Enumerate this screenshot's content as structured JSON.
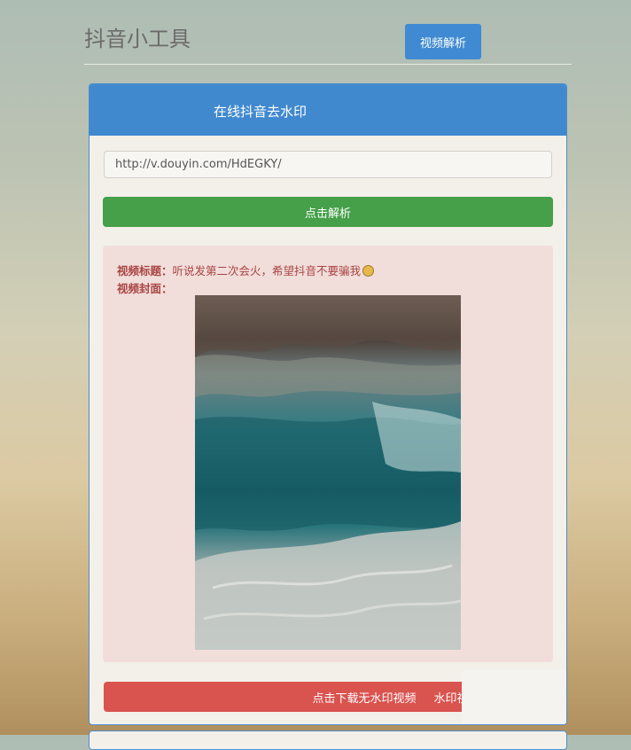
{
  "header": {
    "site_title": "抖音小工具",
    "nav_button": "视频解析"
  },
  "panel": {
    "title": "在线抖音去水印",
    "url_value": "http://v.douyin.com/HdEGKY/",
    "parse_button": "点击解析"
  },
  "result": {
    "title_label": "视频标题：",
    "title_value": "听说发第二次会火，希望抖音不要骗我",
    "cover_label": "视频封面："
  },
  "actions": {
    "download_no_watermark": "点击下载无水印视频",
    "download_watermark": "水印视印视频"
  },
  "colors": {
    "primary": "#4089cf",
    "success": "#45a049",
    "danger": "#d9534f",
    "alert_bg": "#f1dedb",
    "alert_text": "#a94442"
  }
}
